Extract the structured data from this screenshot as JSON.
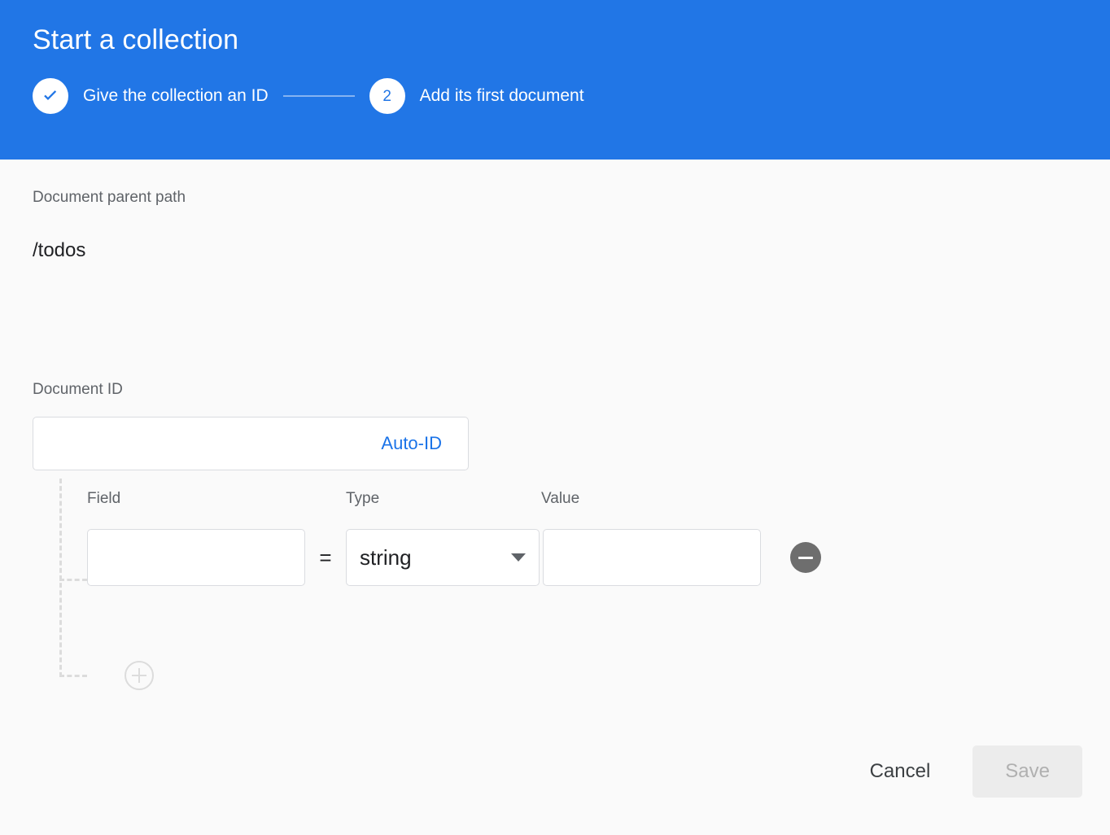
{
  "header": {
    "title": "Start a collection",
    "accent_color": "#2176e6",
    "steps": [
      {
        "id": "step-1",
        "badge_icon": "check-icon",
        "label": "Give the collection an ID",
        "state": "complete"
      },
      {
        "id": "step-2",
        "number": "2",
        "label": "Add its first document",
        "state": "active"
      }
    ]
  },
  "body": {
    "parent_path_label": "Document parent path",
    "parent_path_value": "/todos",
    "document_id_label": "Document ID",
    "document_id_value": "",
    "document_id_placeholder": "",
    "auto_id_label": "Auto-ID",
    "auto_id_color": "#1a73e8",
    "field_headers": {
      "field": "Field",
      "type": "Type",
      "value": "Value"
    },
    "equals": "=",
    "rows": [
      {
        "field_value": "",
        "field_placeholder": "",
        "type_value": "string",
        "value_value": "",
        "value_placeholder": ""
      }
    ],
    "remove_icon": "minus-circle-icon",
    "add_icon": "plus-circle-icon"
  },
  "footer": {
    "cancel_label": "Cancel",
    "save_label": "Save",
    "save_disabled": true
  }
}
